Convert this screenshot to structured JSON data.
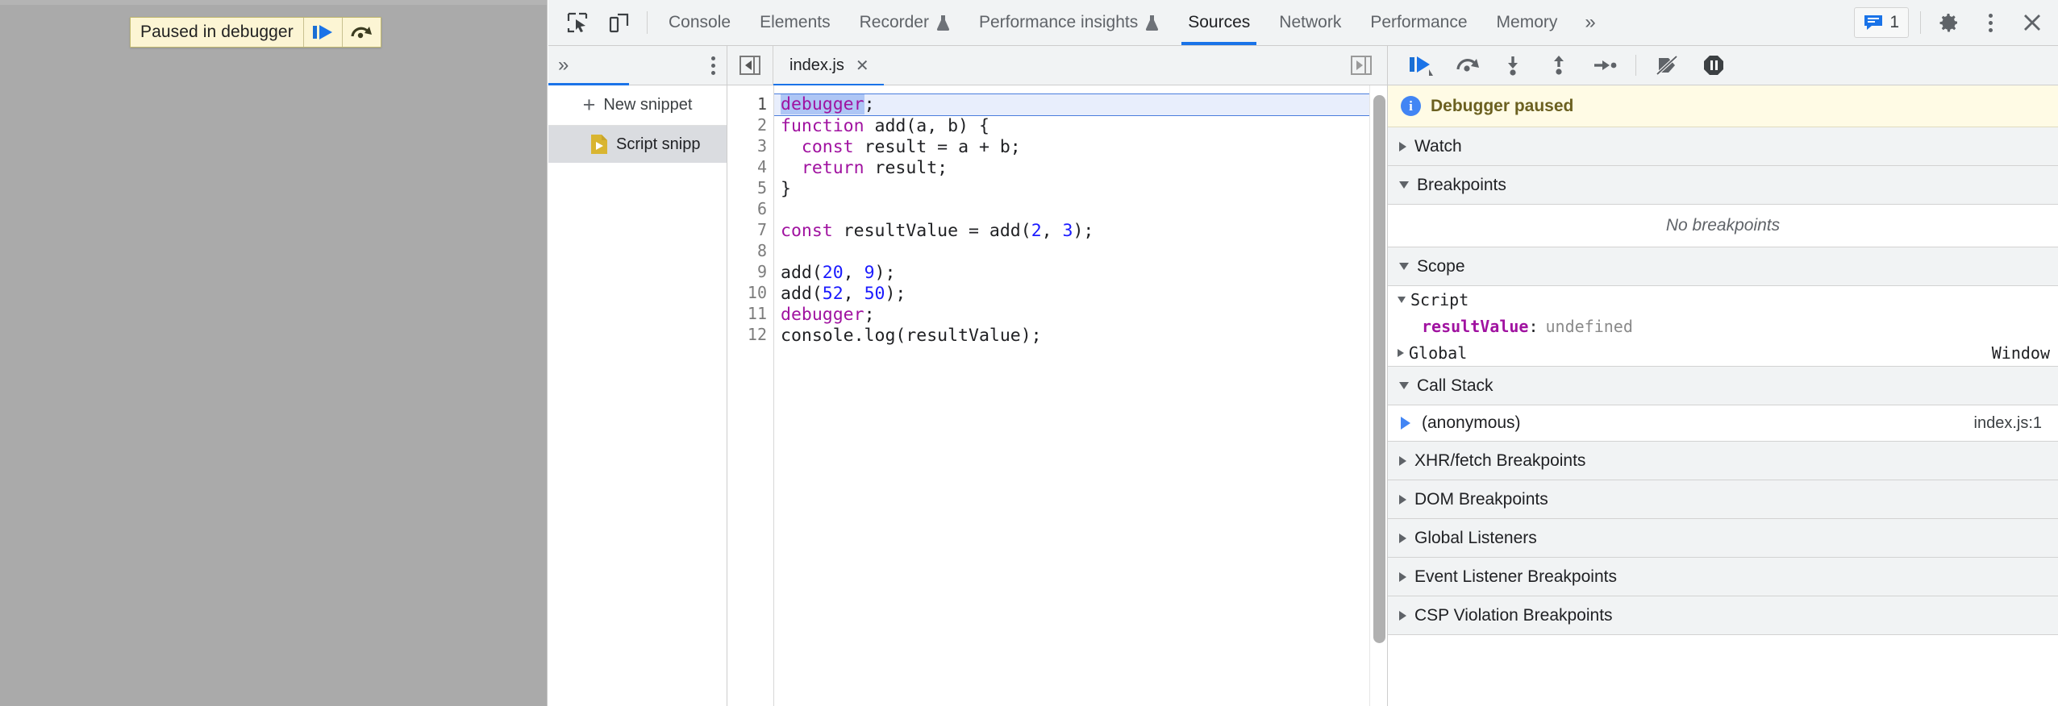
{
  "page_overlay": {
    "paused_banner_text": "Paused in debugger",
    "resume_button_name": "resume-script-execution",
    "step_over_button_name": "step-over-next-function-call"
  },
  "devtools": {
    "toolbar": {
      "inspect_icon": "inspect-element-icon",
      "device_toolbar_icon": "device-toolbar-icon",
      "tabs": [
        {
          "label": "Console",
          "experimental": false,
          "active": false
        },
        {
          "label": "Elements",
          "experimental": false,
          "active": false
        },
        {
          "label": "Recorder",
          "experimental": true,
          "active": false
        },
        {
          "label": "Performance insights",
          "experimental": true,
          "active": false
        },
        {
          "label": "Sources",
          "experimental": false,
          "active": true
        },
        {
          "label": "Network",
          "experimental": false,
          "active": false
        },
        {
          "label": "Performance",
          "experimental": false,
          "active": false
        },
        {
          "label": "Memory",
          "experimental": false,
          "active": false
        }
      ],
      "more_tabs_label": "»",
      "message_count": "1",
      "settings_icon": "gear-icon",
      "kebab_icon": "more-options-icon",
      "close_icon": "close-icon",
      "accent_color": "#1a73e8"
    },
    "navigator": {
      "more_panels_label": "»",
      "kebab_icon": "more-options-icon",
      "new_snippet_label": "New snippet",
      "new_snippet_plus": "+",
      "items": [
        {
          "label": "Script snipp",
          "icon": "snippet-file-icon",
          "selected": true
        }
      ]
    },
    "editor": {
      "panel_toggle_icon": "show-navigator-icon",
      "right_toggle_icon": "show-debugger-icon",
      "tab_label": "index.js",
      "tab_close": "✕",
      "active_line": 1,
      "selection_text": "debugger",
      "lines": [
        {
          "n": "1",
          "tokens": [
            {
              "t": "debugger",
              "c": "kw sel"
            },
            {
              "t": ";",
              "c": "plain"
            }
          ]
        },
        {
          "n": "2",
          "tokens": [
            {
              "t": "function",
              "c": "kw"
            },
            {
              "t": " add(a, b) {",
              "c": "plain"
            }
          ]
        },
        {
          "n": "3",
          "tokens": [
            {
              "t": "  ",
              "c": "plain"
            },
            {
              "t": "const",
              "c": "kw"
            },
            {
              "t": " result = a + b;",
              "c": "plain"
            }
          ]
        },
        {
          "n": "4",
          "tokens": [
            {
              "t": "  ",
              "c": "plain"
            },
            {
              "t": "return",
              "c": "kw"
            },
            {
              "t": " result;",
              "c": "plain"
            }
          ]
        },
        {
          "n": "5",
          "tokens": [
            {
              "t": "}",
              "c": "plain"
            }
          ]
        },
        {
          "n": "6",
          "tokens": [
            {
              "t": "",
              "c": "plain"
            }
          ]
        },
        {
          "n": "7",
          "tokens": [
            {
              "t": "const",
              "c": "kw"
            },
            {
              "t": " resultValue = add(",
              "c": "plain"
            },
            {
              "t": "2",
              "c": "num"
            },
            {
              "t": ", ",
              "c": "plain"
            },
            {
              "t": "3",
              "c": "num"
            },
            {
              "t": ");",
              "c": "plain"
            }
          ]
        },
        {
          "n": "8",
          "tokens": [
            {
              "t": "",
              "c": "plain"
            }
          ]
        },
        {
          "n": "9",
          "tokens": [
            {
              "t": "add(",
              "c": "plain"
            },
            {
              "t": "20",
              "c": "num"
            },
            {
              "t": ", ",
              "c": "plain"
            },
            {
              "t": "9",
              "c": "num"
            },
            {
              "t": ");",
              "c": "plain"
            }
          ]
        },
        {
          "n": "10",
          "tokens": [
            {
              "t": "add(",
              "c": "plain"
            },
            {
              "t": "52",
              "c": "num"
            },
            {
              "t": ", ",
              "c": "plain"
            },
            {
              "t": "50",
              "c": "num"
            },
            {
              "t": ");",
              "c": "plain"
            }
          ]
        },
        {
          "n": "11",
          "tokens": [
            {
              "t": "debugger",
              "c": "kw"
            },
            {
              "t": ";",
              "c": "plain"
            }
          ]
        },
        {
          "n": "12",
          "tokens": [
            {
              "t": "console.log(resultValue);",
              "c": "plain"
            }
          ]
        }
      ]
    },
    "debugger_sidebar": {
      "controls": [
        {
          "name": "resume-script-execution",
          "icon": "resume-icon"
        },
        {
          "name": "step-over-next-function-call",
          "icon": "step-over-icon"
        },
        {
          "name": "step-into-next-function-call",
          "icon": "step-into-icon"
        },
        {
          "name": "step-out-of-current-function",
          "icon": "step-out-icon"
        },
        {
          "name": "step",
          "icon": "step-icon"
        },
        {
          "name": "deactivate-breakpoints",
          "icon": "deactivate-breakpoints-icon"
        },
        {
          "name": "pause-on-exceptions",
          "icon": "pause-on-exceptions-icon"
        }
      ],
      "paused_notice": "Debugger paused",
      "sections": [
        {
          "id": "watch",
          "title": "Watch",
          "expanded": false
        },
        {
          "id": "breakpoints",
          "title": "Breakpoints",
          "expanded": true,
          "empty_text": "No breakpoints"
        },
        {
          "id": "scope",
          "title": "Scope",
          "expanded": true
        },
        {
          "id": "callstack",
          "title": "Call Stack",
          "expanded": true
        },
        {
          "id": "xhr-fetch-breakpoints",
          "title": "XHR/fetch Breakpoints",
          "expanded": false
        },
        {
          "id": "dom-breakpoints",
          "title": "DOM Breakpoints",
          "expanded": false
        },
        {
          "id": "global-listeners",
          "title": "Global Listeners",
          "expanded": false
        },
        {
          "id": "event-listener-breakpoints",
          "title": "Event Listener Breakpoints",
          "expanded": false
        },
        {
          "id": "csp-violation-breakpoints",
          "title": "CSP Violation Breakpoints",
          "expanded": false
        }
      ],
      "scope": {
        "script_label": "Script",
        "script_expanded": true,
        "variables": [
          {
            "name": "resultValue",
            "colon": ":",
            "value": "undefined"
          }
        ],
        "global_label": "Global",
        "global_value": "Window",
        "global_expanded": false
      },
      "call_stack": {
        "frames": [
          {
            "name": "(anonymous)",
            "location": "index.js:1",
            "current": true
          }
        ]
      }
    }
  }
}
